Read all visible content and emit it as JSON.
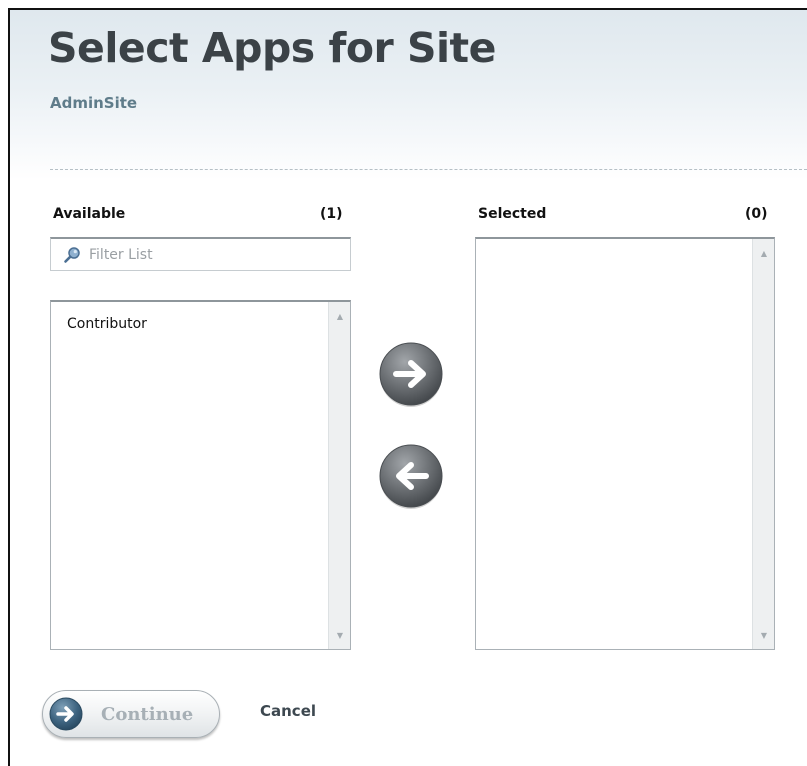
{
  "header": {
    "title": "Select Apps for Site",
    "site_name": "AdminSite"
  },
  "available": {
    "label": "Available",
    "count": "(1)",
    "filter_placeholder": "Filter List",
    "items": [
      "Contributor"
    ]
  },
  "selected": {
    "label": "Selected",
    "count": "(0)",
    "items": []
  },
  "actions": {
    "continue_label": "Continue",
    "cancel_label": "Cancel"
  },
  "icons": {
    "filter": "search-icon",
    "add": "arrow-right-icon",
    "remove": "arrow-left-icon",
    "continue": "arrow-right-circle-icon"
  },
  "colors": {
    "title": "#3b4247",
    "site_name": "#5f7c8a",
    "button_gray": "#6b6f73",
    "continue_disabled_text": "#a7b0b6"
  }
}
